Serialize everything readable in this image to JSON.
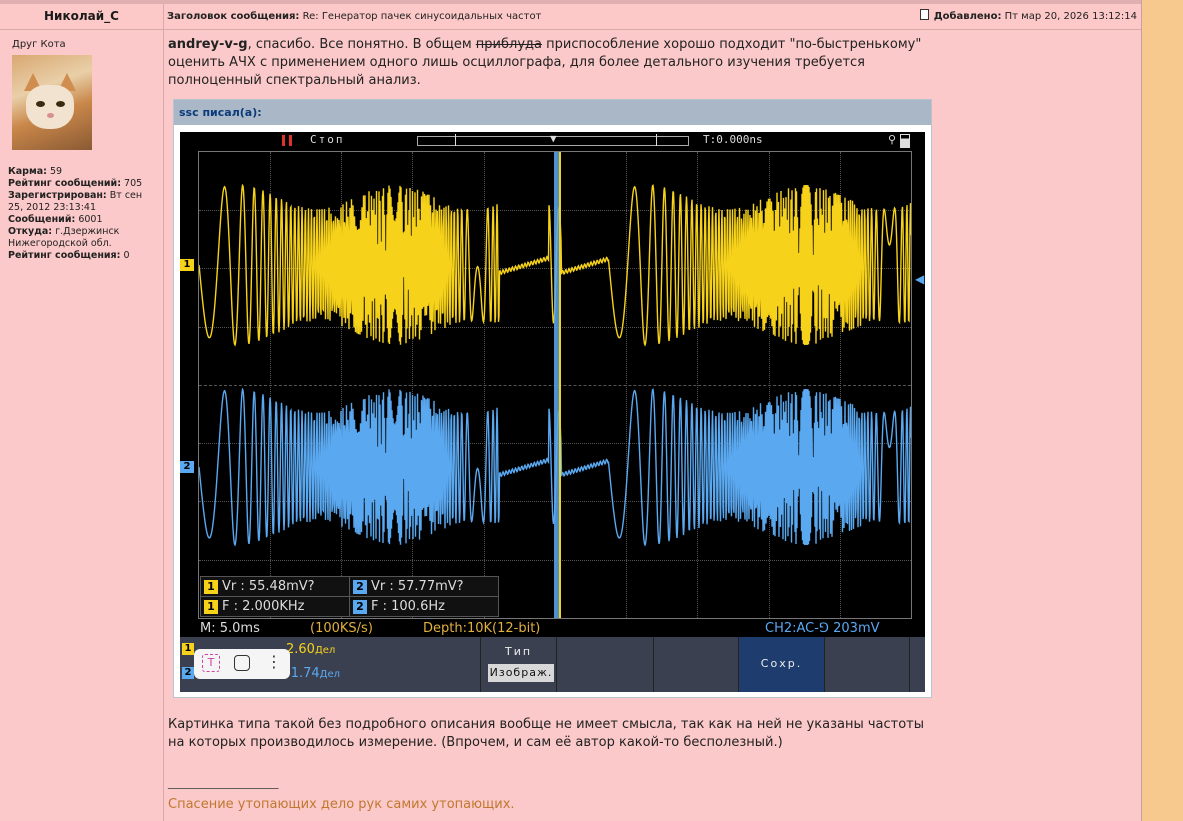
{
  "header": {
    "author": "Николай_С",
    "subject_label": "Заголовок сообщения:",
    "subject": "Re: Генератор пачек синусоидальных частот",
    "added_label": "Добавлено:",
    "added": "Пт мар 20, 2026 13:12:14"
  },
  "profile": {
    "rank": "Друг Кота",
    "karma_label": "Карма:",
    "karma": "59",
    "rating_label": "Рейтинг сообщений:",
    "rating": "705",
    "registered_label": "Зарегистрирован:",
    "registered": "Вт сен 25, 2012 23:13:41",
    "posts_label": "Сообщений:",
    "posts": "6001",
    "from_label": "Откуда:",
    "from": "г.Дзержинск Нижегородской обл.",
    "rating2_label": "Рейтинг сообщения:",
    "rating2": "0"
  },
  "message": {
    "name": "andrey-v-g",
    "p1": ", спасибо. Все понятно. В общем ",
    "struck": "приблуда",
    "p2": " приспособление хорошо подходит \"по-быстренькому\" оценить АЧХ с применением одного лишь осциллографа, для более детального изучения требуется полноценный спектральный анализ."
  },
  "quote": {
    "header": "ssc писал(а):"
  },
  "scope": {
    "stop": "Стоп",
    "time": "T:0.000ns",
    "ch1_marker": "1",
    "ch2_marker": "2",
    "meas": {
      "ch1_vr": "Vr : 55.48mV?",
      "ch2_vr": "Vr : 57.77mV?",
      "ch1_f": "F : 2.000KHz",
      "ch2_f": "F : 100.6Hz"
    },
    "status": {
      "timebase": "M: 5.0ms",
      "rate": "(100KS/s)",
      "depth": "Depth:10K(12-bit)",
      "trigger": "CH2:AC-⅁ 203mV"
    },
    "bottom": {
      "ch1_value": "2.60",
      "ch1_unit": "Дел",
      "ch2_value": "-1.74",
      "ch2_unit": "Дел",
      "type_label": "Тип",
      "image_label": "Изображ.",
      "save_label": "Сохр."
    },
    "colors": {
      "ch1": "#f7d21a",
      "ch2": "#5aa8f0"
    }
  },
  "signature": {
    "text": "Картинка типа такой без подробного описания вообще не имеет смысла, так как на ней не указаны частоты на которых производилось измерение. (Впрочем, и сам её автор какой-то бесполезный.)",
    "line": "_________________",
    "motto": "Спасение утопающих дело рук самих утопающих."
  }
}
